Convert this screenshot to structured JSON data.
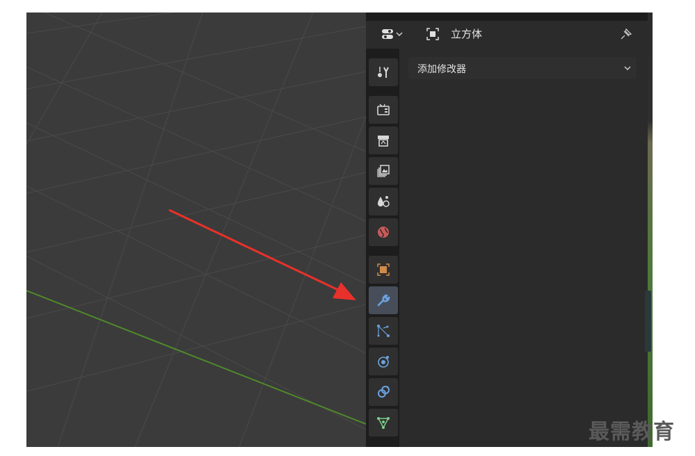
{
  "header": {
    "editor_icon": "properties-editor-icon",
    "object_icon": "object-data-icon",
    "object_name": "立方体",
    "pin_icon": "pin-icon"
  },
  "tabs": [
    {
      "name": "tool",
      "icon": "tool-icon"
    },
    {
      "name": "render",
      "icon": "render-icon"
    },
    {
      "name": "output",
      "icon": "output-icon"
    },
    {
      "name": "view-layer",
      "icon": "view-layer-icon"
    },
    {
      "name": "scene",
      "icon": "scene-icon"
    },
    {
      "name": "world",
      "icon": "world-icon"
    },
    {
      "name": "object",
      "icon": "object-icon"
    },
    {
      "name": "modifiers",
      "icon": "wrench-icon",
      "active": true
    },
    {
      "name": "particles",
      "icon": "particles-icon"
    },
    {
      "name": "physics",
      "icon": "physics-icon"
    },
    {
      "name": "constraints",
      "icon": "constraints-icon"
    },
    {
      "name": "data",
      "icon": "mesh-data-icon"
    }
  ],
  "modifiers": {
    "add_modifier_label": "添加修改器"
  },
  "watermark": "最需教育",
  "colors": {
    "viewport_bg": "#3b3b3b",
    "grid": "#4a4a4a",
    "y_axis": "#4f8a2a",
    "active_tab": "#474e5a",
    "annotation_arrow": "#e8312a",
    "object_orange": "#d08b4a",
    "world_red": "#c85a5a"
  }
}
